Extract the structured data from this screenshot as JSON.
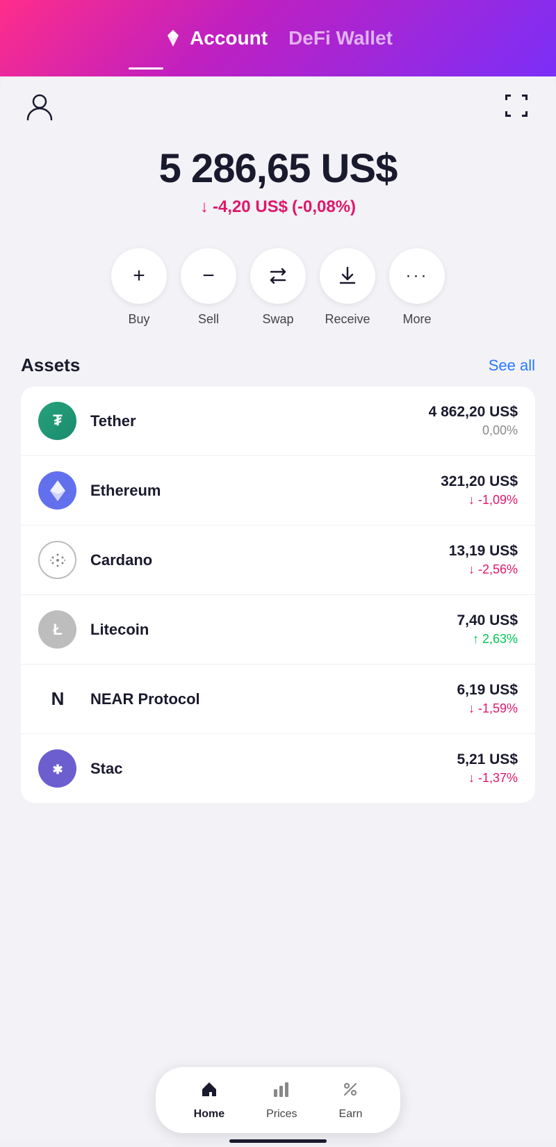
{
  "header": {
    "account_label": "Account",
    "defi_label": "DeFi Wallet"
  },
  "balance": {
    "amount": "5 286,65 US$",
    "change_amount": "-4,20 US$",
    "change_percent": "(-0,08%)"
  },
  "actions": [
    {
      "id": "buy",
      "label": "Buy",
      "icon": "+"
    },
    {
      "id": "sell",
      "label": "Sell",
      "icon": "−"
    },
    {
      "id": "swap",
      "label": "Swap",
      "icon": "⇄"
    },
    {
      "id": "receive",
      "label": "Receive",
      "icon": "↓"
    },
    {
      "id": "more",
      "label": "More",
      "icon": "···"
    }
  ],
  "assets_section": {
    "title": "Assets",
    "see_all": "See all"
  },
  "assets": [
    {
      "name": "Tether",
      "amount": "4 862,20 US$",
      "change": "0,00%",
      "change_type": "neutral",
      "icon_type": "tether"
    },
    {
      "name": "Ethereum",
      "amount": "321,20 US$",
      "change": "↓ -1,09%",
      "change_type": "down",
      "icon_type": "eth"
    },
    {
      "name": "Cardano",
      "amount": "13,19 US$",
      "change": "↓ -2,56%",
      "change_type": "down",
      "icon_type": "ada"
    },
    {
      "name": "Litecoin",
      "amount": "7,40 US$",
      "change": "↑ 2,63%",
      "change_type": "up",
      "icon_type": "ltc"
    },
    {
      "name": "NEAR Protocol",
      "amount": "6,19 US$",
      "change": "↓ -1,59%",
      "change_type": "down",
      "icon_type": "near"
    },
    {
      "name": "Stac",
      "amount": "5,21 US$",
      "change": "↓ -1,37%",
      "change_type": "down",
      "icon_type": "stac"
    }
  ],
  "bottom_nav": [
    {
      "id": "home",
      "label": "Home",
      "icon": "🏠",
      "active": true
    },
    {
      "id": "prices",
      "label": "Prices",
      "icon": "📊",
      "active": false
    },
    {
      "id": "earn",
      "label": "Earn",
      "icon": "%",
      "active": false
    }
  ]
}
